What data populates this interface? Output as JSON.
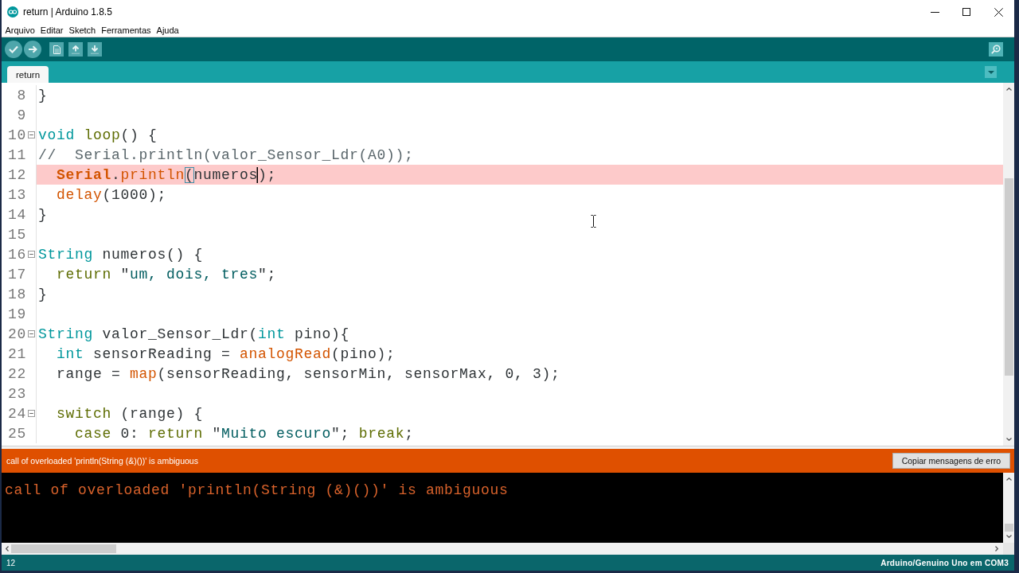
{
  "window": {
    "title": "return | Arduino 1.8.5"
  },
  "menu": [
    "Arquivo",
    "Editar",
    "Sketch",
    "Ferramentas",
    "Ajuda"
  ],
  "tabs": [
    {
      "label": "return",
      "selected": true
    }
  ],
  "editor": {
    "lines": [
      {
        "number": "8",
        "foldable": false,
        "highlighted": false,
        "tokens": [
          {
            "kind": "plain",
            "text": "}"
          }
        ]
      },
      {
        "number": "9",
        "foldable": false,
        "highlighted": false
      },
      {
        "number": "10",
        "foldable": true,
        "highlighted": false,
        "tokens": [
          {
            "kind": "type",
            "text": "void "
          },
          {
            "kind": "control",
            "text": "loop"
          },
          {
            "kind": "plain",
            "text": "() {"
          }
        ]
      },
      {
        "number": "11",
        "foldable": false,
        "highlighted": false,
        "tokens": [
          {
            "kind": "comment",
            "text": "//  Serial.println(valor_Sensor_Ldr(A0));"
          }
        ]
      },
      {
        "number": "12",
        "foldable": false,
        "highlighted": true,
        "tokens": [
          {
            "kind": "builtin",
            "text": "  Serial"
          },
          {
            "kind": "plain",
            "text": "."
          },
          {
            "kind": "function",
            "text": "println"
          },
          {
            "kind": "bracket-match",
            "text": "("
          },
          {
            "kind": "caret-end",
            "text": "numeros"
          },
          {
            "kind": "plain",
            "text": ");"
          }
        ]
      },
      {
        "number": "13",
        "foldable": false,
        "highlighted": false,
        "tokens": [
          {
            "kind": "function",
            "text": "  delay"
          },
          {
            "kind": "plain",
            "text": "(1000);"
          }
        ]
      },
      {
        "number": "14",
        "foldable": false,
        "highlighted": false,
        "tokens": [
          {
            "kind": "plain",
            "text": "}"
          }
        ]
      },
      {
        "number": "15",
        "foldable": false,
        "highlighted": false
      },
      {
        "number": "16",
        "foldable": true,
        "highlighted": false,
        "tokens": [
          {
            "kind": "type",
            "text": "String "
          },
          {
            "kind": "plain",
            "text": "numeros() {"
          }
        ]
      },
      {
        "number": "17",
        "foldable": false,
        "highlighted": false,
        "tokens": [
          {
            "kind": "control",
            "text": "  return "
          },
          {
            "kind": "plain",
            "text": "\""
          },
          {
            "kind": "string",
            "text": "um, dois, tres"
          },
          {
            "kind": "plain",
            "text": "\";"
          }
        ]
      },
      {
        "number": "18",
        "foldable": false,
        "highlighted": false,
        "tokens": [
          {
            "kind": "plain",
            "text": "}"
          }
        ]
      },
      {
        "number": "19",
        "foldable": false,
        "highlighted": false
      },
      {
        "number": "20",
        "foldable": true,
        "highlighted": false,
        "tokens": [
          {
            "kind": "type",
            "text": "String "
          },
          {
            "kind": "plain",
            "text": "valor_Sensor_Ldr("
          },
          {
            "kind": "type",
            "text": "int "
          },
          {
            "kind": "plain",
            "text": "pino){"
          }
        ]
      },
      {
        "number": "21",
        "foldable": false,
        "highlighted": false,
        "tokens": [
          {
            "kind": "type",
            "text": "  int "
          },
          {
            "kind": "plain",
            "text": "sensorReading = "
          },
          {
            "kind": "function",
            "text": "analogRead"
          },
          {
            "kind": "plain",
            "text": "(pino);"
          }
        ]
      },
      {
        "number": "22",
        "foldable": false,
        "highlighted": false,
        "tokens": [
          {
            "kind": "plain",
            "text": "  range = "
          },
          {
            "kind": "function",
            "text": "map"
          },
          {
            "kind": "plain",
            "text": "(sensorReading, sensorMin, sensorMax, 0, 3);"
          }
        ]
      },
      {
        "number": "23",
        "foldable": false,
        "highlighted": false
      },
      {
        "number": "24",
        "foldable": true,
        "highlighted": false,
        "tokens": [
          {
            "kind": "control",
            "text": "  switch "
          },
          {
            "kind": "plain",
            "text": "(range) {"
          }
        ]
      },
      {
        "number": "25",
        "foldable": false,
        "highlighted": false,
        "tokens": [
          {
            "kind": "control",
            "text": "    case "
          },
          {
            "kind": "plain",
            "text": "0: "
          },
          {
            "kind": "control",
            "text": "return "
          },
          {
            "kind": "plain",
            "text": "\""
          },
          {
            "kind": "string",
            "text": "Muito escuro"
          },
          {
            "kind": "plain",
            "text": "\"; "
          },
          {
            "kind": "control",
            "text": "break"
          },
          {
            "kind": "plain",
            "text": ";"
          }
        ]
      }
    ]
  },
  "error_bar": {
    "message": "call of overloaded 'println(String (&)())' is ambiguous",
    "button": "Copiar mensagens de erro"
  },
  "console": {
    "lines": [
      "call of overloaded 'println(String (&)())' is ambiguous"
    ]
  },
  "status_bar": {
    "line": "12",
    "board": "Arduino/Genuino Uno em COM3"
  }
}
